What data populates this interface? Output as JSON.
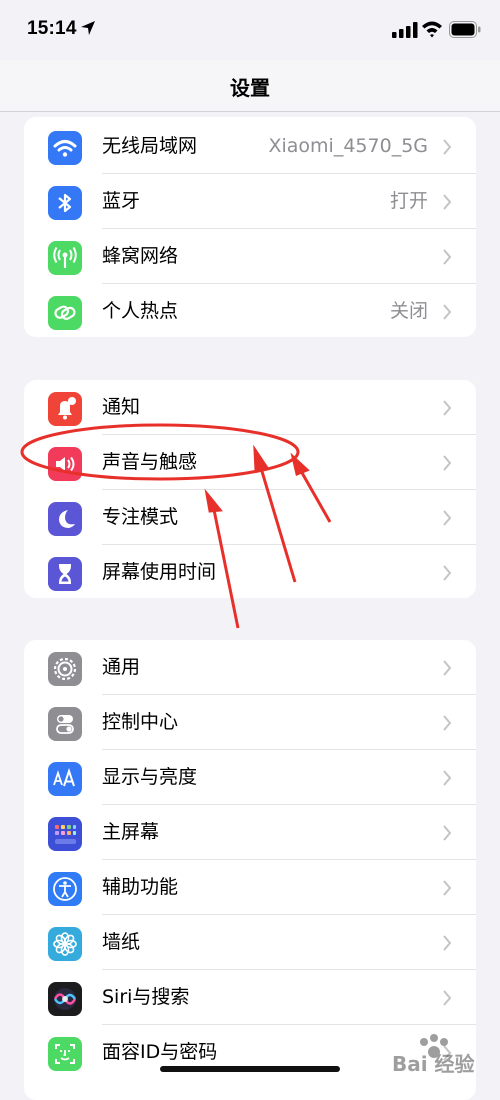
{
  "status_bar": {
    "time": "15:14",
    "icons": [
      "location-arrow-icon",
      "cellular-signal-icon",
      "wifi-icon",
      "battery-icon"
    ]
  },
  "nav": {
    "title": "设置"
  },
  "groups": [
    {
      "items": [
        {
          "label": "无线局域网",
          "value": "Xiaomi_4570_5G",
          "icon": "wifi-icon",
          "color": "#3478f6"
        },
        {
          "label": "蓝牙",
          "value": "打开",
          "icon": "bluetooth-icon",
          "color": "#3478f6"
        },
        {
          "label": "蜂窝网络",
          "value": "",
          "icon": "antenna-icon",
          "color": "#4cd964"
        },
        {
          "label": "个人热点",
          "value": "关闭",
          "icon": "hotspot-link-icon",
          "color": "#4cd964"
        }
      ]
    },
    {
      "items": [
        {
          "label": "通知",
          "value": "",
          "icon": "bell-icon",
          "color": "#f04438"
        },
        {
          "label": "声音与触感",
          "value": "",
          "icon": "speaker-icon",
          "color": "#f23b5a"
        },
        {
          "label": "专注模式",
          "value": "",
          "icon": "moon-icon",
          "color": "#5b56d6"
        },
        {
          "label": "屏幕使用时间",
          "value": "",
          "icon": "hourglass-icon",
          "color": "#5b56d6"
        }
      ]
    },
    {
      "items": [
        {
          "label": "通用",
          "value": "",
          "icon": "gear-icon",
          "color": "#8e8e93"
        },
        {
          "label": "控制中心",
          "value": "",
          "icon": "toggles-icon",
          "color": "#8e8e93"
        },
        {
          "label": "显示与亮度",
          "value": "",
          "icon": "text-size-icon",
          "color": "#3478f6"
        },
        {
          "label": "主屏幕",
          "value": "",
          "icon": "home-grid-icon",
          "color": "#3d4fd6"
        },
        {
          "label": "辅助功能",
          "value": "",
          "icon": "accessibility-icon",
          "color": "#2f7cf6"
        },
        {
          "label": "墙纸",
          "value": "",
          "icon": "flower-icon",
          "color": "#35aadc"
        },
        {
          "label": "Siri与搜索",
          "value": "",
          "icon": "siri-icon",
          "color": "#1c1c1e"
        },
        {
          "label": "面容ID与密码",
          "value": "",
          "icon": "face-id-icon",
          "color": "#4cd964"
        }
      ]
    }
  ],
  "watermark": {
    "text": "Bai 经验"
  }
}
